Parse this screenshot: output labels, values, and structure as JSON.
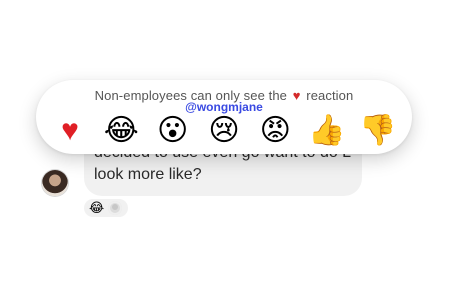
{
  "message": {
    "line1": "decided to use even go want to do L",
    "line2": "look more like?"
  },
  "message_reactions": {
    "emoji": "😂",
    "emoji_icon": "face-with-tears-of-joy-icon"
  },
  "picker": {
    "note_before": "Non-employees can only see the",
    "note_heart": "♥",
    "note_after": "reaction",
    "handle": "@wongmjane",
    "reactions": [
      {
        "glyph": "♥",
        "icon": "heart-icon"
      },
      {
        "glyph": "😂",
        "icon": "face-with-tears-of-joy-icon"
      },
      {
        "glyph": "😮",
        "icon": "face-with-open-mouth-icon"
      },
      {
        "glyph": "😢",
        "icon": "crying-face-icon"
      },
      {
        "glyph": "😡",
        "icon": "angry-face-icon"
      },
      {
        "glyph": "👍",
        "icon": "thumbs-up-icon"
      },
      {
        "glyph": "👎",
        "icon": "thumbs-down-icon"
      }
    ]
  },
  "colors": {
    "heart": "#e01f26",
    "handle": "#3a4ae2",
    "bubble": "#f1f1f1"
  }
}
